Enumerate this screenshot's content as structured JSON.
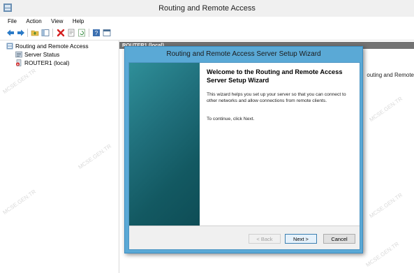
{
  "window": {
    "title": "Routing and Remote Access"
  },
  "menu": {
    "items": [
      "File",
      "Action",
      "View",
      "Help"
    ]
  },
  "toolbar": {
    "icons": [
      "back-arrow-icon",
      "forward-arrow-icon",
      "up-folder-icon",
      "show-hide-tree-icon",
      "delete-icon",
      "properties-icon",
      "refresh-icon",
      "help-icon",
      "console-icon"
    ]
  },
  "tree": {
    "root": "Routing and Remote Access",
    "items": [
      "Server Status",
      "ROUTER1 (local)"
    ]
  },
  "right_pane": {
    "header": "ROUTER1 (local)",
    "note": "outing and Remote"
  },
  "wizard": {
    "title": "Routing and Remote Access Server Setup Wizard",
    "heading": "Welcome to the Routing and Remote Access Server Setup Wizard",
    "paragraph": "This wizard helps you set up your server so that you can connect to other networks and allow connections from remote clients.",
    "continue_text": "To continue, click Next.",
    "buttons": {
      "back": "< Back",
      "next": "Next >",
      "cancel": "Cancel"
    }
  },
  "watermark": {
    "text": "MCSE.GEN.TR"
  },
  "colors": {
    "wizard_frame": "#5aa9d6",
    "banner_dark": "#0e4d56",
    "banner_light": "#2f8f99",
    "header_gray": "#727272"
  }
}
